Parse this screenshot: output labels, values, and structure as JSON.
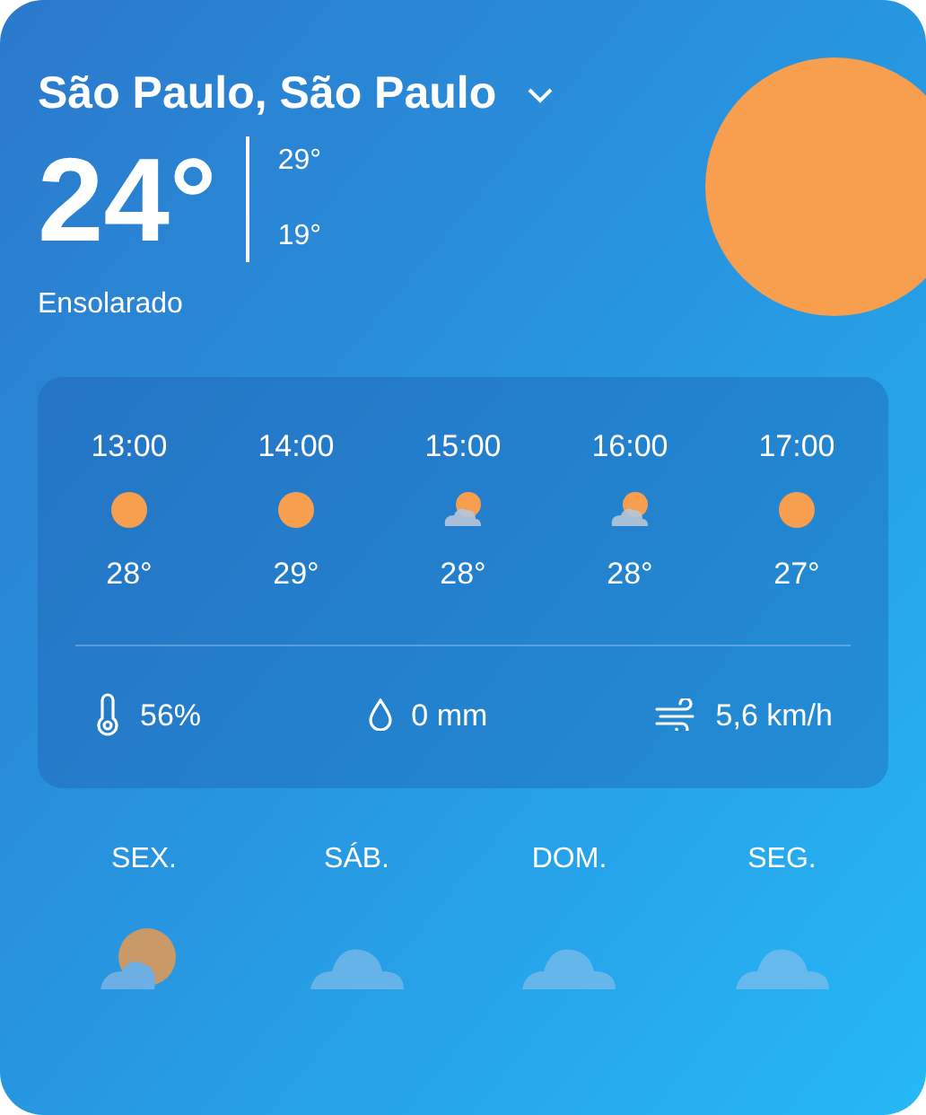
{
  "location": {
    "title": "São Paulo, São Paulo"
  },
  "current": {
    "temperature": "24°",
    "high": "29°",
    "low": "19°",
    "condition": "Ensolarado",
    "kind": "sun"
  },
  "hourly": [
    {
      "time": "13:00",
      "kind": "sun",
      "temperature": "28°"
    },
    {
      "time": "14:00",
      "kind": "sun",
      "temperature": "29°"
    },
    {
      "time": "15:00",
      "kind": "partly_cloudy",
      "temperature": "28°"
    },
    {
      "time": "16:00",
      "kind": "partly_cloudy",
      "temperature": "28°"
    },
    {
      "time": "17:00",
      "kind": "sun",
      "temperature": "27°"
    }
  ],
  "details": [
    {
      "kind": "humidity",
      "value": "56%"
    },
    {
      "kind": "precipitation",
      "value": "0 mm"
    },
    {
      "kind": "wind",
      "value": "5,6 km/h"
    }
  ],
  "daily": [
    {
      "day": "SEX.",
      "kind": "partly_cloudy"
    },
    {
      "day": "SÁB.",
      "kind": "cloud"
    },
    {
      "day": "DOM.",
      "kind": "cloud"
    },
    {
      "day": "SEG.",
      "kind": "cloud"
    }
  ]
}
